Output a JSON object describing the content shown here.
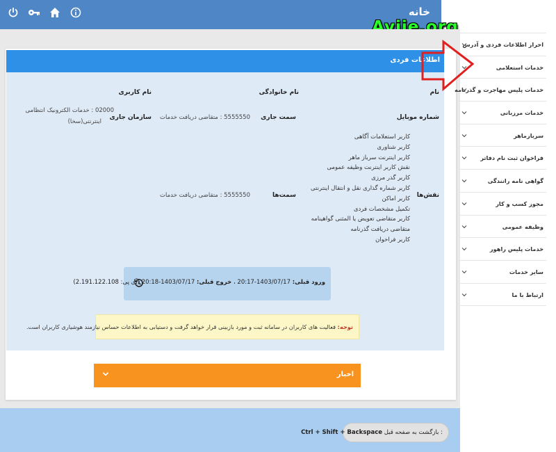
{
  "header": {
    "title": "خانه",
    "icons": [
      "power-icon",
      "key-icon",
      "home-icon",
      "info-icon"
    ]
  },
  "watermark": "Avije.org",
  "card": {
    "title": "اطلاعات فردی",
    "fields": {
      "name_label": "نام",
      "family_label": "نام خانوادگی",
      "username_label": "نام کاربری",
      "mobile_label": "شماره موبایل",
      "current_position_label": "سمت جاری",
      "current_position_value": "5555550 : متقاضی دریافت خدمات",
      "current_org_label": "سازمان جاری",
      "current_org_value_line1": "02000 : خدمات الکترونیک انتظامی",
      "current_org_value_line2": "اینترنتی(سخا)",
      "roles_label": "نقش‌ها",
      "positions_label": "سمت‌ها",
      "positions_value": "5555550 : متقاضی دریافت خدمات"
    },
    "roles": [
      "کاربر استعلامات آگاهی",
      "کاربر شناوری",
      "کاربر اینترنت سرباز ماهر",
      "نقش کاربر اینترنت وظیفه عمومی",
      "کاربر گذر مرزی",
      "کاربر شماره گذاری نقل و انتقال اینترنتی",
      "کاربر اماکن",
      "تکمیل مشخصات فردی",
      "کاربر متقاضی تعویض یا المثنی گواهینامه",
      "متقاضی دریافت گذرنامه",
      "کاربر فراخوان"
    ],
    "login": {
      "prev_login_label": "ورود قبلی:",
      "prev_login_value": "1403/07/17-20:17",
      "prev_logout_label": "خروج قبلی:",
      "prev_logout_value": "1403/07/17-20:18",
      "ip_text": "(آی پی: 2.191.122.108)"
    },
    "notice": {
      "label": "توجه:",
      "text": "فعالیت های کاربران در سامانه ثبت و مورد بازبینی قرار خواهد گرفت و دستیابی به اطلاعات حساس نیازمند هوشیاری کاربران است."
    }
  },
  "news": {
    "label": "اخبار"
  },
  "footer": {
    "back_keys": "Ctrl + Shift + Backspace",
    "back_text": ": بازگشت به صفحه قبل"
  },
  "sidebar": {
    "items": [
      "احراز اطلاعات فردی و آدرس",
      "خدمات استعلامی",
      "خدمات پلیس مهاجرت و گذرنامه",
      "خدمات مرزبانی",
      "سربازماهر",
      "فراخوان ثبت نام دفاتر",
      "گواهی نامه رانندگی",
      "مجوز کسب و کار",
      "وظیفه عمومی",
      "خدمات پلیس راهور",
      "سایر خدمات",
      "ارتباط با ما"
    ]
  },
  "colors": {
    "header": "#4f86c6",
    "card_header": "#2f90e8",
    "card_body": "#dfeaf7",
    "news": "#f7931e",
    "footer": "#a9cdf0",
    "watermark": "#29ff29",
    "annotation_arrow": "#e0201f"
  }
}
